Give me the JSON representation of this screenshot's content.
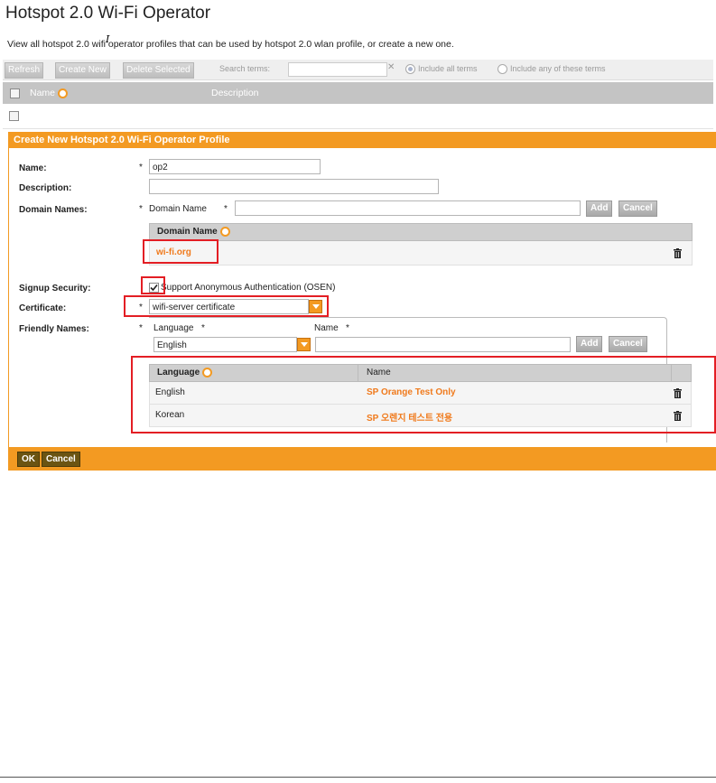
{
  "page": {
    "title": "Hotspot 2.0 Wi-Fi Operator",
    "description": "View all hotspot 2.0 wifi operator profiles that can be used by hotspot 2.0 wlan profile, or create a new one."
  },
  "toolbar": {
    "refresh_label": "Refresh",
    "create_new_label": "Create New",
    "delete_selected_label": "Delete Selected",
    "search_label": "Search terms:",
    "search_value": "",
    "clear_icon": "✕",
    "radio_all_label": "Include all terms",
    "radio_any_label": "Include any of these terms",
    "radio_selected": "all"
  },
  "list": {
    "columns": [
      "Name",
      "Description"
    ],
    "rows": []
  },
  "form": {
    "title": "Create New Hotspot 2.0 Wi-Fi Operator Profile",
    "name_label": "Name:",
    "name_value": "op2",
    "description_label": "Description:",
    "description_value": "",
    "domain_names_label": "Domain Names:",
    "domain_name_field_label": "Domain Name",
    "domain_name_value": "",
    "add_label": "Add",
    "cancel_label": "Cancel",
    "domain_table": {
      "header": "Domain Name",
      "rows": [
        {
          "domain": "wi-fi.org"
        }
      ]
    },
    "signup_security_label": "Signup Security:",
    "signup_checkbox_checked": true,
    "signup_checkbox_label": "Support Anonymous Authentication (OSEN)",
    "certificate_label": "Certificate:",
    "certificate_value": "wifi-server certificate",
    "friendly_names_label": "Friendly Names:",
    "language_field_label": "Language",
    "language_value": "English",
    "name_field_label": "Name",
    "friendly_name_value": "",
    "friendly_table": {
      "columns": [
        "Language",
        "Name"
      ],
      "rows": [
        {
          "language": "English",
          "name": "SP Orange Test Only"
        },
        {
          "language": "Korean",
          "name": "SP 오렌지 테스트 전용"
        }
      ]
    },
    "required_mark": "*",
    "ok_label": "OK",
    "footer_cancel_label": "Cancel"
  },
  "colors": {
    "accent": "#f39a22",
    "highlight": "#e31e24",
    "link": "#f07a1c"
  }
}
